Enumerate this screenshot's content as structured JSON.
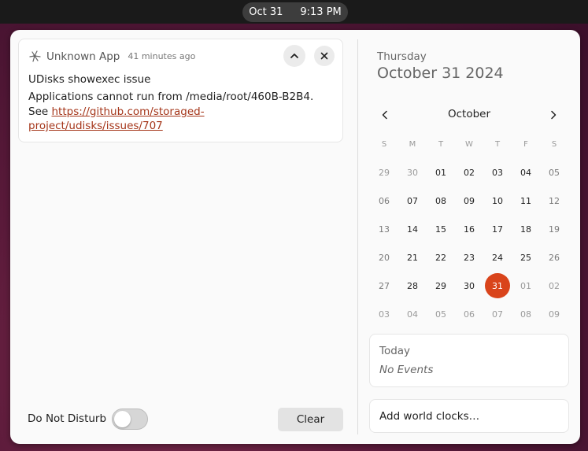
{
  "topbar": {
    "date": "Oct 31",
    "time": "9:13 PM"
  },
  "notification": {
    "app_icon": "unknown-app-icon",
    "app_name": "Unknown App",
    "time_ago": "41 minutes ago",
    "title": "UDisks showexec issue",
    "body_line1": "Applications cannot run from  /media/root/460B-B2B4.",
    "body_see": "See ",
    "link": "https://github.com/storaged-project/udisks/issues/707",
    "collapse_icon": "chevron-up-icon",
    "close_icon": "close-icon"
  },
  "footer": {
    "dnd_label": "Do Not Disturb",
    "dnd_enabled": false,
    "clear_label": "Clear"
  },
  "calendar": {
    "weekday": "Thursday",
    "full_date": "October 31 2024",
    "month": "October",
    "day_headers": [
      "S",
      "M",
      "T",
      "W",
      "T",
      "F",
      "S"
    ],
    "weeks": [
      [
        "29",
        "30",
        "01",
        "02",
        "03",
        "04",
        "05"
      ],
      [
        "06",
        "07",
        "08",
        "09",
        "10",
        "11",
        "12"
      ],
      [
        "13",
        "14",
        "15",
        "16",
        "17",
        "18",
        "19"
      ],
      [
        "20",
        "21",
        "22",
        "23",
        "24",
        "25",
        "26"
      ],
      [
        "27",
        "28",
        "29",
        "30",
        "31",
        "01",
        "02"
      ],
      [
        "03",
        "04",
        "05",
        "06",
        "07",
        "08",
        "09"
      ]
    ],
    "selected_day": "31",
    "accent_color": "#d9441b"
  },
  "events": {
    "title": "Today",
    "empty_text": "No Events"
  },
  "world_clocks": {
    "label": "Add world clocks…"
  }
}
